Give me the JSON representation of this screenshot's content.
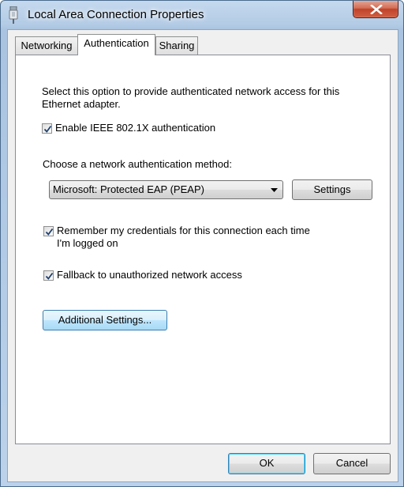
{
  "window": {
    "title": "Local Area Connection Properties"
  },
  "tabs": [
    {
      "label": "Networking"
    },
    {
      "label": "Authentication"
    },
    {
      "label": "Sharing"
    }
  ],
  "authentication": {
    "description_line1": "Select this option to provide authenticated network access for this",
    "description_line2": "Ethernet adapter.",
    "enable_8021x": {
      "label": "Enable IEEE 802.1X authentication",
      "checked": true
    },
    "method_prompt": "Choose a network authentication method:",
    "method_select": {
      "value": "Microsoft: Protected EAP (PEAP)"
    },
    "settings_button": "Settings",
    "remember_credentials": {
      "label_line1": "Remember my credentials for this connection each time",
      "label_line2": "I'm logged on",
      "checked": true
    },
    "fallback": {
      "label": "Fallback to unauthorized network access",
      "checked": true
    },
    "additional_settings_button": "Additional Settings..."
  },
  "footer": {
    "ok_label": "OK",
    "cancel_label": "Cancel"
  },
  "colors": {
    "close_button": "#c0432a",
    "focus_border": "#3c7fb1"
  }
}
